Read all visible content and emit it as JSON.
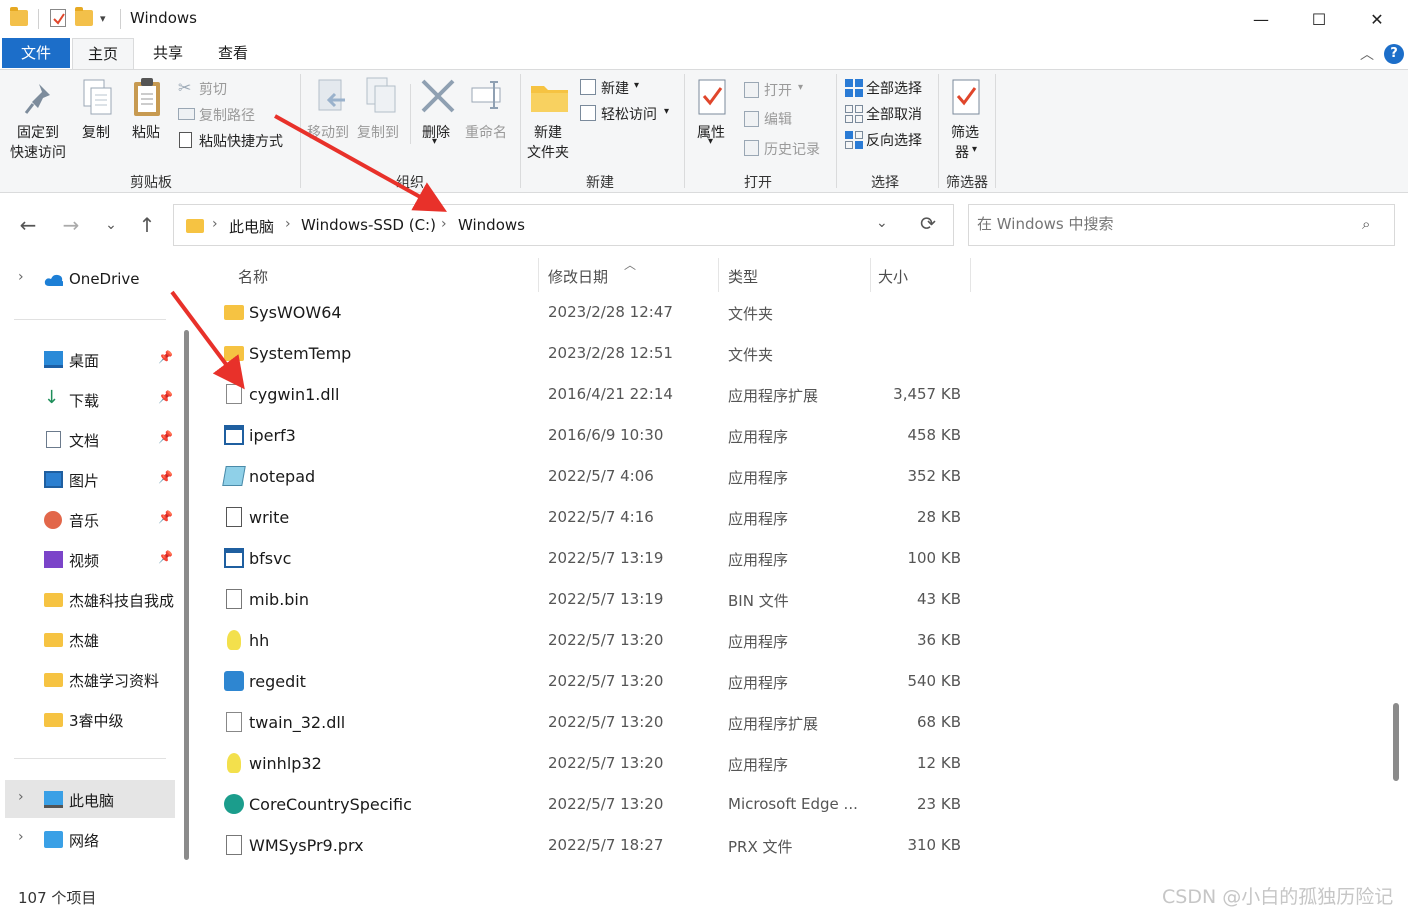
{
  "window": {
    "title": "Windows",
    "minimize": "—",
    "maximize": "☐",
    "close": "✕"
  },
  "menu_tabs": {
    "file": "文件",
    "home": "主页",
    "share": "共享",
    "view": "查看"
  },
  "ribbon": {
    "clipboard": {
      "group_label": "剪贴板",
      "pin_line1": "固定到",
      "pin_line2": "快速访问",
      "copy": "复制",
      "paste": "粘贴",
      "cut": "剪切",
      "copy_path": "复制路径",
      "paste_shortcut": "粘贴快捷方式"
    },
    "organize": {
      "group_label": "组织",
      "move_to": "移动到",
      "copy_to": "复制到",
      "delete": "删除",
      "rename": "重命名"
    },
    "new": {
      "group_label": "新建",
      "new_folder_line1": "新建",
      "new_folder_line2": "文件夹",
      "new_item": "新建",
      "easy_access": "轻松访问"
    },
    "open": {
      "group_label": "打开",
      "properties": "属性",
      "open": "打开",
      "edit": "编辑",
      "history": "历史记录"
    },
    "select": {
      "group_label": "选择",
      "select_all": "全部选择",
      "select_none": "全部取消",
      "invert": "反向选择"
    },
    "filter": {
      "group_label": "筛选器",
      "filter_line1": "筛选",
      "filter_line2": "器"
    }
  },
  "address": {
    "crumbs": [
      "此电脑",
      "Windows-SSD (C:)",
      "Windows"
    ],
    "search_placeholder": "在 Windows 中搜索"
  },
  "nav": {
    "onedrive": "OneDrive",
    "quick": [
      {
        "label": "桌面",
        "icon": "desktop-icon",
        "pinned": true
      },
      {
        "label": "下载",
        "icon": "download-icon",
        "pinned": true
      },
      {
        "label": "文档",
        "icon": "documents-icon",
        "pinned": true
      },
      {
        "label": "图片",
        "icon": "pictures-icon",
        "pinned": true
      },
      {
        "label": "音乐",
        "icon": "music-icon",
        "pinned": true
      },
      {
        "label": "视频",
        "icon": "videos-icon",
        "pinned": true
      },
      {
        "label": "杰雄科技自我成",
        "icon": "folder-icon",
        "pinned": false
      },
      {
        "label": "杰雄",
        "icon": "folder-icon",
        "pinned": false
      },
      {
        "label": "杰雄学习资料",
        "icon": "folder-icon",
        "pinned": false
      },
      {
        "label": "3睿中级",
        "icon": "folder-icon",
        "pinned": false
      }
    ],
    "this_pc": "此电脑",
    "network": "网络"
  },
  "columns": {
    "name": "名称",
    "modified": "修改日期",
    "type": "类型",
    "size": "大小"
  },
  "files": [
    {
      "name": "SysWOW64",
      "date": "2023/2/28 12:47",
      "type": "文件夹",
      "size": "",
      "icon": "folder-icon"
    },
    {
      "name": "SystemTemp",
      "date": "2023/2/28 12:51",
      "type": "文件夹",
      "size": "",
      "icon": "folder-icon"
    },
    {
      "name": "cygwin1.dll",
      "date": "2016/4/21 22:14",
      "type": "应用程序扩展",
      "size": "3,457 KB",
      "icon": "dll-icon"
    },
    {
      "name": "iperf3",
      "date": "2016/6/9 10:30",
      "type": "应用程序",
      "size": "458 KB",
      "icon": "exe-icon"
    },
    {
      "name": "notepad",
      "date": "2022/5/7 4:06",
      "type": "应用程序",
      "size": "352 KB",
      "icon": "notepad-icon"
    },
    {
      "name": "write",
      "date": "2022/5/7 4:16",
      "type": "应用程序",
      "size": "28 KB",
      "icon": "write-icon"
    },
    {
      "name": "bfsvc",
      "date": "2022/5/7 13:19",
      "type": "应用程序",
      "size": "100 KB",
      "icon": "exe-icon"
    },
    {
      "name": "mib.bin",
      "date": "2022/5/7 13:19",
      "type": "BIN 文件",
      "size": "43 KB",
      "icon": "file-icon"
    },
    {
      "name": "hh",
      "date": "2022/5/7 13:20",
      "type": "应用程序",
      "size": "36 KB",
      "icon": "help-icon"
    },
    {
      "name": "regedit",
      "date": "2022/5/7 13:20",
      "type": "应用程序",
      "size": "540 KB",
      "icon": "regedit-icon"
    },
    {
      "name": "twain_32.dll",
      "date": "2022/5/7 13:20",
      "type": "应用程序扩展",
      "size": "68 KB",
      "icon": "dll-icon"
    },
    {
      "name": "winhlp32",
      "date": "2022/5/7 13:20",
      "type": "应用程序",
      "size": "12 KB",
      "icon": "help-icon"
    },
    {
      "name": "CoreCountrySpecific",
      "date": "2022/5/7 13:20",
      "type": "Microsoft Edge ...",
      "size": "23 KB",
      "icon": "edge-icon"
    },
    {
      "name": "WMSysPr9.prx",
      "date": "2022/5/7 18:27",
      "type": "PRX 文件",
      "size": "310 KB",
      "icon": "file-icon"
    }
  ],
  "status": {
    "item_count": "107 个项目"
  },
  "watermark": "CSDN @小白的孤独历险记",
  "colors": {
    "accent": "#1c6ec9",
    "folder": "#f6c342",
    "annotation_arrow": "#e8312a"
  }
}
